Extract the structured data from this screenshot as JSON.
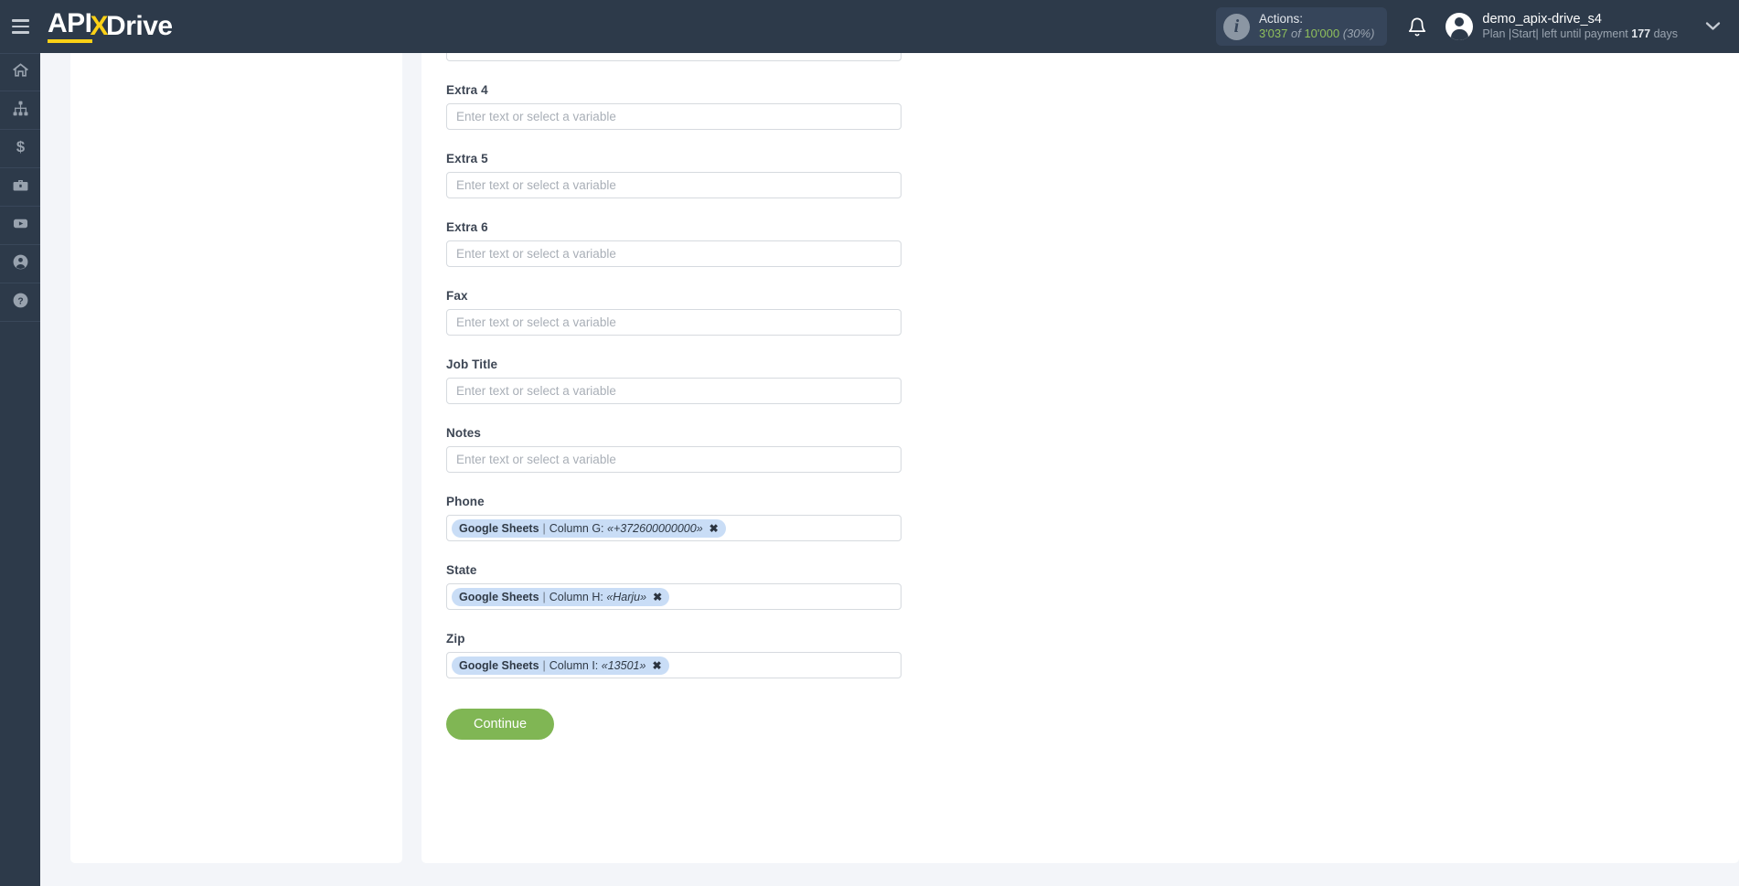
{
  "header": {
    "menu_icon": "hamburger-icon",
    "brand_api": "API",
    "brand_x": "X",
    "brand_drive": "Drive",
    "actions": {
      "label": "Actions:",
      "used": "3'037",
      "of": "of",
      "total": "10'000",
      "percent": "(30%)"
    },
    "bell_icon": "notification-bell-icon",
    "user": {
      "name": "demo_apix-drive_s4",
      "plan_prefix": "Plan |Start| left until payment",
      "days_value": "177",
      "days_suffix": "days"
    },
    "caret_icon": "chevron-down-icon"
  },
  "sidebar": {
    "items": [
      {
        "name": "home",
        "icon": "home-icon"
      },
      {
        "name": "connections",
        "icon": "sitemap-icon"
      },
      {
        "name": "billing",
        "icon": "dollar-icon"
      },
      {
        "name": "briefcase",
        "icon": "briefcase-icon"
      },
      {
        "name": "video",
        "icon": "youtube-icon"
      },
      {
        "name": "account",
        "icon": "user-circle-icon"
      },
      {
        "name": "help",
        "icon": "question-circle-icon"
      }
    ]
  },
  "form": {
    "placeholder": "Enter text or select a variable",
    "fields": [
      {
        "label": "Extra 4",
        "type": "text",
        "value": ""
      },
      {
        "label": "Extra 5",
        "type": "text",
        "value": ""
      },
      {
        "label": "Extra 6",
        "type": "text",
        "value": ""
      },
      {
        "label": "Fax",
        "type": "text",
        "value": ""
      },
      {
        "label": "Job Title",
        "type": "text",
        "value": ""
      },
      {
        "label": "Notes",
        "type": "text",
        "value": ""
      },
      {
        "label": "Phone",
        "type": "tag",
        "tag": {
          "source": "Google Sheets",
          "sep": "|",
          "column": "Column G:",
          "value": "«+372600000000»",
          "remove": "✖"
        }
      },
      {
        "label": "State",
        "type": "tag",
        "tag": {
          "source": "Google Sheets",
          "sep": "|",
          "column": "Column H:",
          "value": "«Harju»",
          "remove": "✖"
        }
      },
      {
        "label": "Zip",
        "type": "tag",
        "tag": {
          "source": "Google Sheets",
          "sep": "|",
          "column": "Column I:",
          "value": "«13501»",
          "remove": "✖"
        }
      }
    ],
    "continue_label": "Continue"
  },
  "colors": {
    "header_bg": "#2d3a4a",
    "brand_accent": "#fcd116",
    "quota_green": "#8fbf5c",
    "continue_green": "#80b654",
    "tag_bg": "#c9ddf6",
    "page_bg": "#f3f5f9"
  }
}
